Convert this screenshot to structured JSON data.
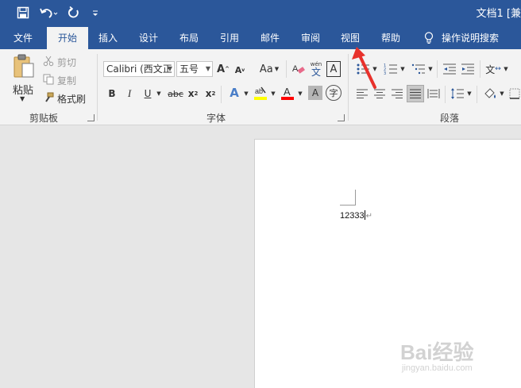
{
  "window": {
    "title": "文档1 [兼"
  },
  "tabs": [
    "文件",
    "开始",
    "插入",
    "设计",
    "布局",
    "引用",
    "邮件",
    "审阅",
    "视图",
    "帮助",
    "操作说明搜索"
  ],
  "clipboard": {
    "paste": "粘贴",
    "cut": "剪切",
    "copy": "复制",
    "format_painter": "格式刷",
    "group_label": "剪贴板"
  },
  "font": {
    "name": "Calibri (西文正",
    "size": "五号",
    "group_label": "字体",
    "pinyin_top": "wén",
    "pinyin_char": "文",
    "change_case": "Aa"
  },
  "paragraph": {
    "group_label": "段落"
  },
  "document": {
    "text": "12333"
  },
  "watermark": {
    "brand": "Bai经验",
    "url": "jingyan.baidu.com"
  },
  "colors": {
    "title_bar": "#2b579a",
    "highlight": "#ffff00",
    "font_color": "#ff0000",
    "annotation_arrow": "#e8312b"
  }
}
